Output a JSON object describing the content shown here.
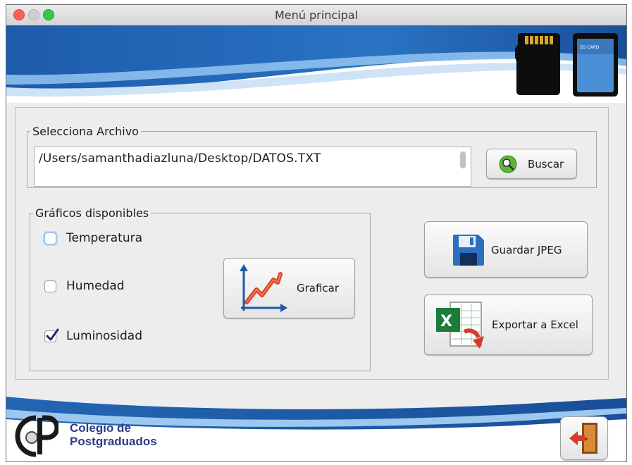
{
  "window": {
    "title": "Menú principal"
  },
  "file_group": {
    "legend": "Selecciona Archivo",
    "path_value": "/Users/samanthadiazluna/Desktop/DATOS.TXT",
    "search_button": "Buscar"
  },
  "charts_group": {
    "legend": "Gráficos disponibles",
    "options": [
      {
        "label": "Temperatura",
        "checked": false
      },
      {
        "label": "Humedad",
        "checked": false
      },
      {
        "label": "Luminosidad",
        "checked": true
      }
    ],
    "plot_button": "Graficar"
  },
  "actions": {
    "save_jpeg": "Guardar JPEG",
    "export_excel": "Exportar a Excel"
  },
  "footer": {
    "logo_initials": "CP",
    "logo_line1": "Colegio de",
    "logo_line2": "Postgraduados"
  },
  "colors": {
    "banner_blue": "#1c5fae",
    "banner_light": "#5a97d8",
    "excel_green": "#1e7c3a",
    "exit_door": "#c8822f",
    "exit_arrow": "#d63a2c"
  }
}
